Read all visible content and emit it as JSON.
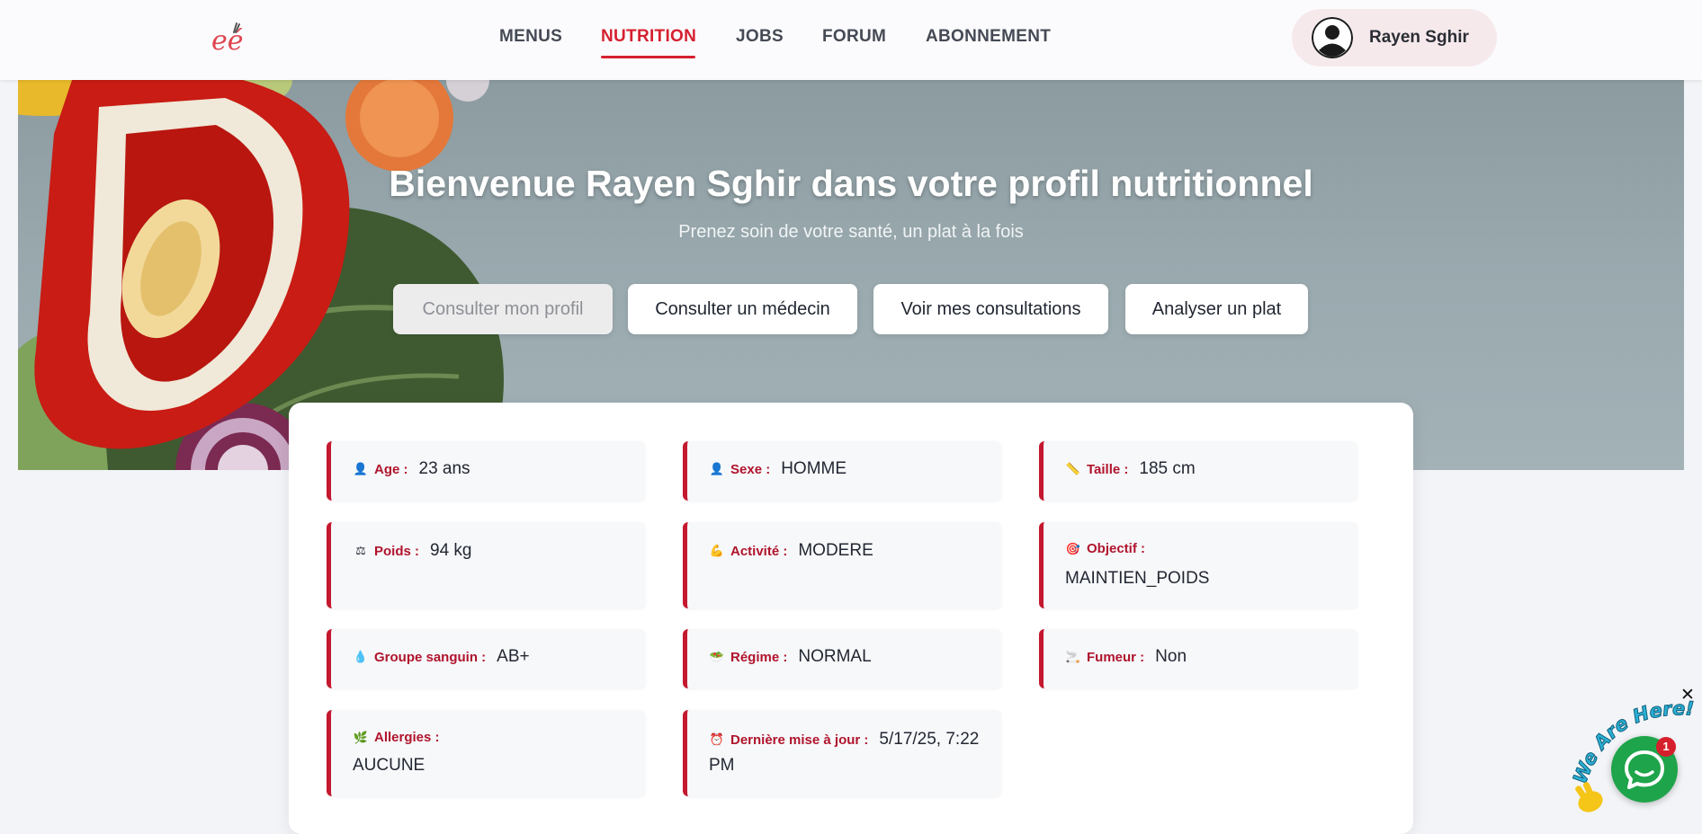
{
  "header": {
    "logo_text": "eé",
    "nav": [
      {
        "label": "MENUS",
        "active": false
      },
      {
        "label": "NUTRITION",
        "active": true
      },
      {
        "label": "JOBS",
        "active": false
      },
      {
        "label": "FORUM",
        "active": false
      },
      {
        "label": "ABONNEMENT",
        "active": false
      }
    ],
    "user_name": "Rayen Sghir",
    "avatar_icon": "user-circle-icon",
    "accent_color": "#d6202f"
  },
  "hero": {
    "title": "Bienvenue Rayen Sghir dans votre profil nutritionnel",
    "subtitle": "Prenez soin de votre santé, un plat à la fois",
    "buttons": [
      {
        "label": "Consulter mon profil",
        "state": "disabled"
      },
      {
        "label": "Consulter un médecin",
        "state": "enabled"
      },
      {
        "label": "Voir mes consultations",
        "state": "enabled"
      },
      {
        "label": "Analyser un plat",
        "state": "enabled"
      }
    ]
  },
  "profile": {
    "age": {
      "icon": "👤",
      "icon_name": "person-icon",
      "label": "Age :",
      "value": "23 ans"
    },
    "sexe": {
      "icon": "👤",
      "icon_name": "person-icon",
      "label": "Sexe :",
      "value": "HOMME"
    },
    "taille": {
      "icon": "📏",
      "icon_name": "ruler-icon",
      "label": "Taille :",
      "value": "185 cm"
    },
    "poids": {
      "icon": "⚖",
      "icon_name": "scale-icon",
      "label": "Poids :",
      "value": "94 kg"
    },
    "activite": {
      "icon": "💪",
      "icon_name": "flexed-arm-icon",
      "label": "Activité :",
      "value": "MODERE"
    },
    "objectif": {
      "icon": "🎯",
      "icon_name": "target-icon",
      "label": "Objectif :",
      "value": "MAINTIEN_POIDS"
    },
    "groupe": {
      "icon": "💧",
      "icon_name": "blood-drop-icon",
      "label": "Groupe sanguin :",
      "value": "AB+"
    },
    "regime": {
      "icon": "🥗",
      "icon_name": "salad-icon",
      "label": "Régime :",
      "value": "NORMAL"
    },
    "fumeur": {
      "icon": "🚬",
      "icon_name": "cigarette-icon",
      "label": "Fumeur :",
      "value": "Non"
    },
    "allergies": {
      "icon": "🌿",
      "icon_name": "herb-icon",
      "label": "Allergies :",
      "value": "AUCUNE"
    },
    "maj": {
      "icon": "⏰",
      "icon_name": "alarm-clock-icon",
      "label": "Dernière mise à jour :",
      "value_line1": "5/17/25, 7:22",
      "value_line2": "PM"
    }
  },
  "chat_widget": {
    "tagline": "We Are Here!",
    "badge_count": "1",
    "close_glyph": "✕",
    "color": "#1ea44a"
  }
}
